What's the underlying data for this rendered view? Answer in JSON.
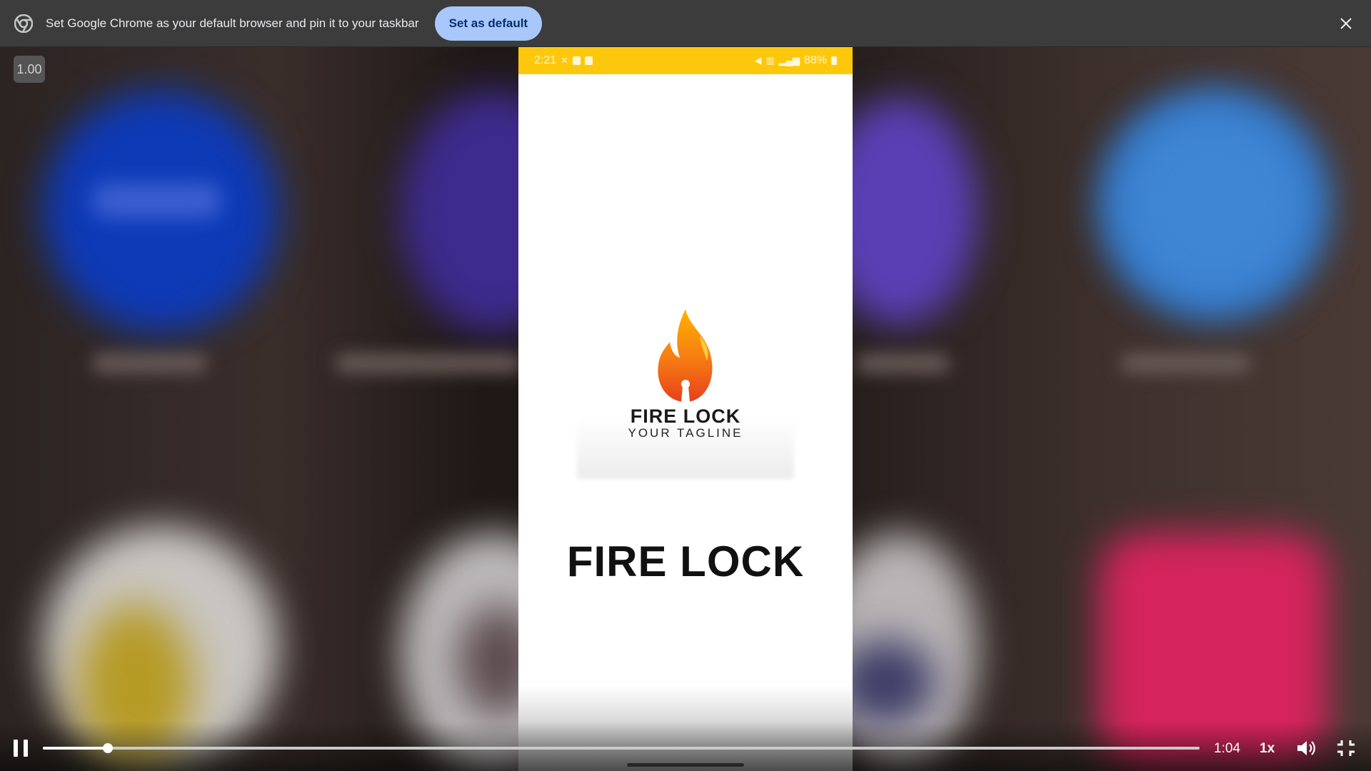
{
  "infobar": {
    "message": "Set Google Chrome as your default browser and pin it to your taskbar",
    "set_default_label": "Set as default",
    "icons": {
      "logo": "chrome-logo-icon",
      "close": "close-icon"
    }
  },
  "player": {
    "playback_rate_badge": "1.00",
    "current_time": "1:04",
    "speed_label": "1x",
    "progress": 0.056,
    "icons": {
      "play_pause": "pause-icon",
      "volume": "volume-icon",
      "fullscreen": "exit-fullscreen-icon"
    }
  },
  "phone": {
    "status_bar": {
      "time": "2:21",
      "battery": "88%",
      "background": "#fdc80b"
    },
    "splash": {
      "logo_brand": "FIRE LOCK",
      "logo_tagline": "YOUR TAGLINE",
      "title": "FIRE LOCK"
    }
  },
  "colors": {
    "infobar_bg": "#3c3c3c",
    "button_bg": "#a8c7fa",
    "button_text": "#062e6f"
  }
}
